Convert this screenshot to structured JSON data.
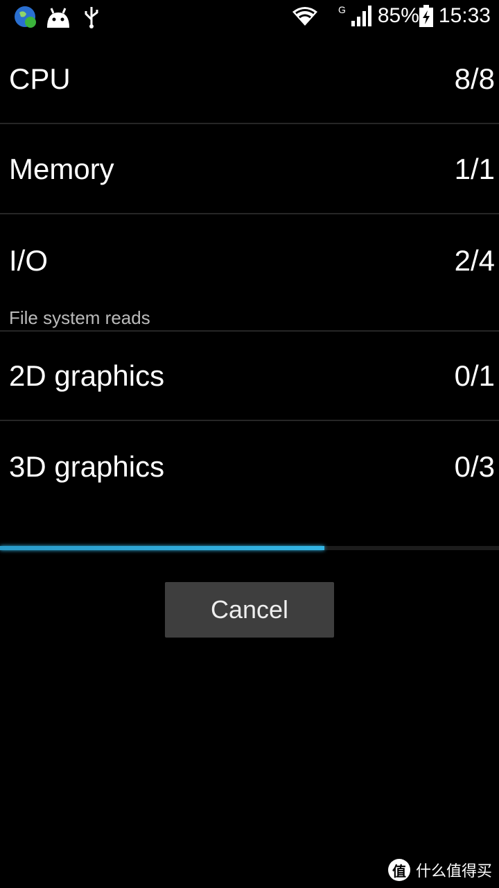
{
  "status_bar": {
    "icons_left": [
      "globe-sync-icon",
      "android-icon",
      "usb-icon"
    ],
    "icons_right": [
      "wifi-icon",
      "signal-icon",
      "battery-charging-icon"
    ],
    "network_type": "G",
    "battery": "85%",
    "time": "15:33"
  },
  "rows": [
    {
      "label": "CPU",
      "value": "8/8"
    },
    {
      "label": "Memory",
      "value": "1/1"
    },
    {
      "label": "I/O",
      "value": "2/4"
    },
    {
      "label": "2D graphics",
      "value": "0/1"
    },
    {
      "label": "3D graphics",
      "value": "0/3"
    }
  ],
  "current_test": "File system reads",
  "progress_percent": 65,
  "progress_color": "#33b5e5",
  "cancel_label": "Cancel",
  "watermark": "什么值得买",
  "watermark_logo": "值"
}
